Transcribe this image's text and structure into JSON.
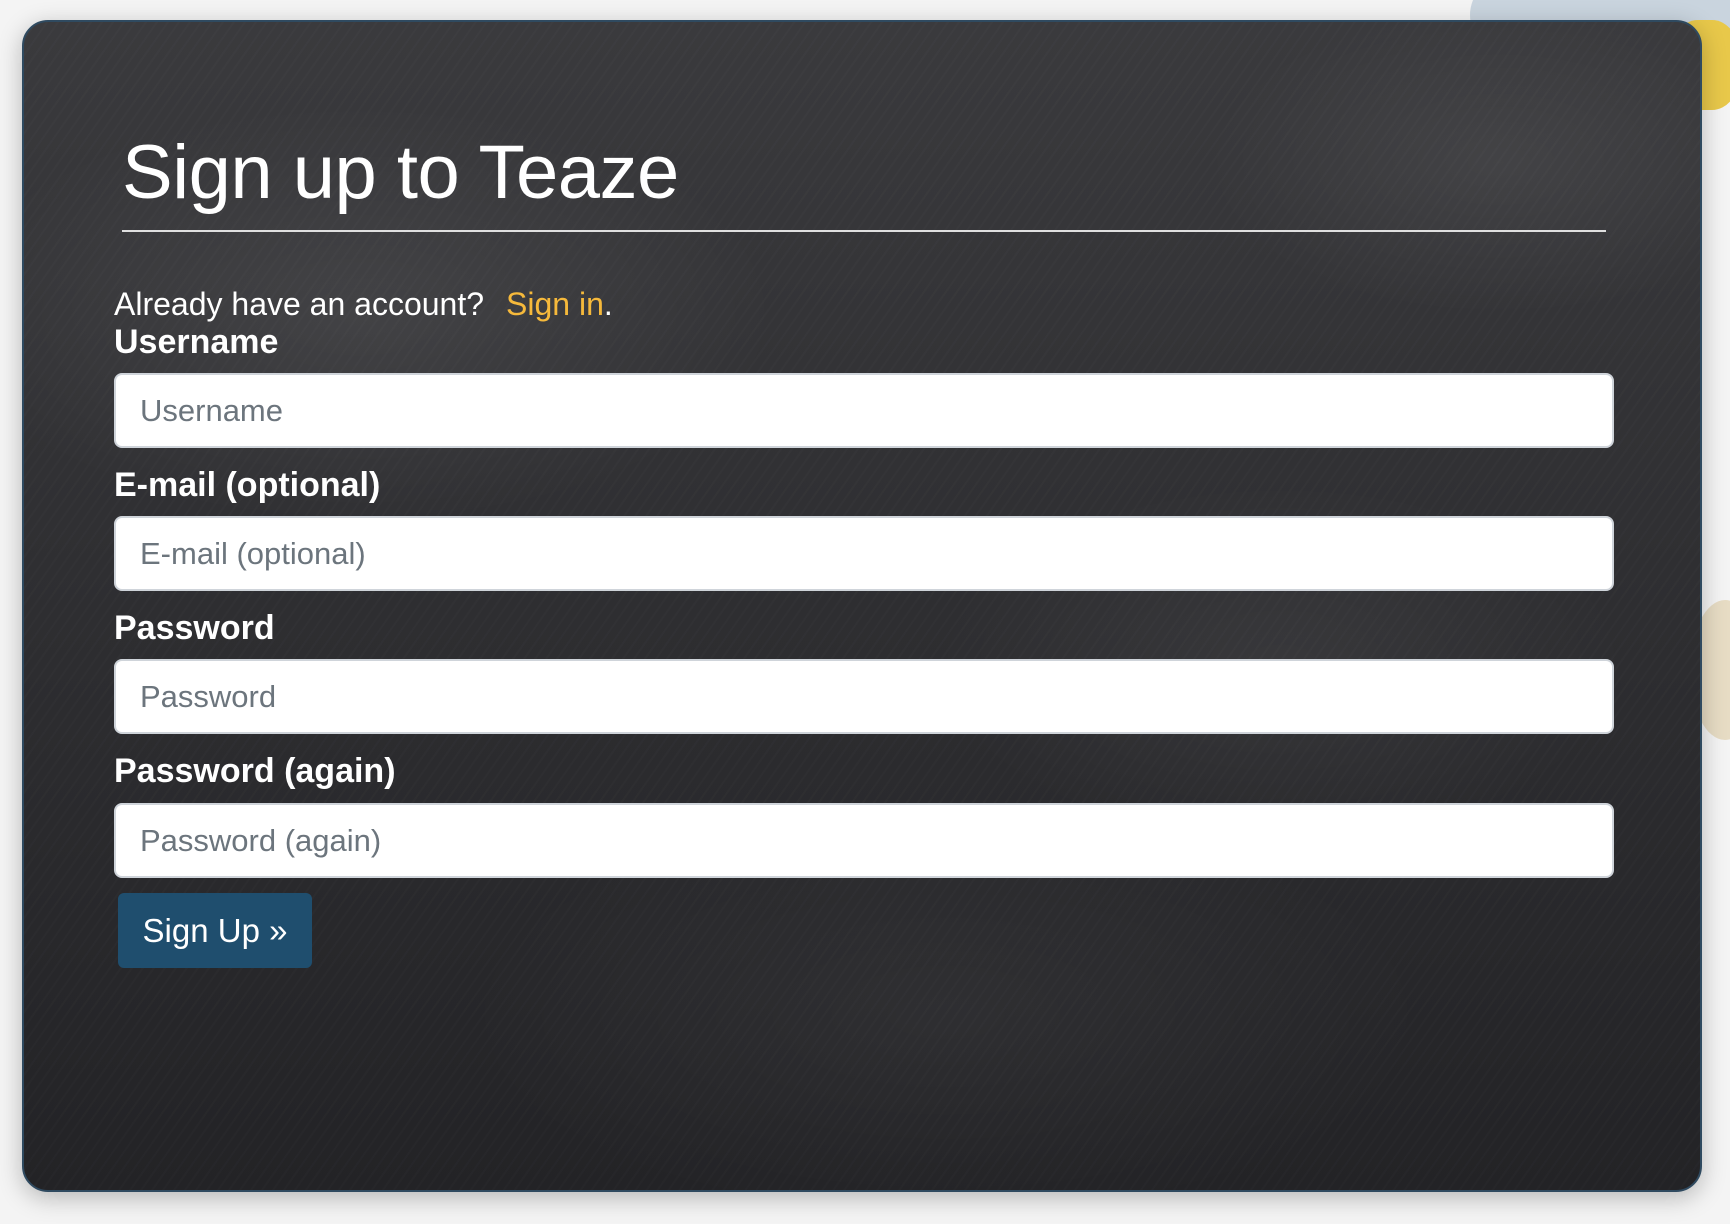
{
  "page": {
    "title": "Sign up to Teaze"
  },
  "signin_prompt": {
    "text": "Already have an account?",
    "link_label": "Sign in",
    "suffix": "."
  },
  "form": {
    "fields": [
      {
        "label": "Username",
        "placeholder": "Username",
        "value": ""
      },
      {
        "label": "E-mail (optional)",
        "placeholder": "E-mail (optional)",
        "value": ""
      },
      {
        "label": "Password",
        "placeholder": "Password",
        "value": ""
      },
      {
        "label": "Password (again)",
        "placeholder": "Password (again)",
        "value": ""
      }
    ],
    "submit_label": "Sign Up »"
  },
  "colors": {
    "accent_link": "#f6b93b",
    "button_bg": "#1f4e6e",
    "panel_bg": "#2e2e30"
  }
}
